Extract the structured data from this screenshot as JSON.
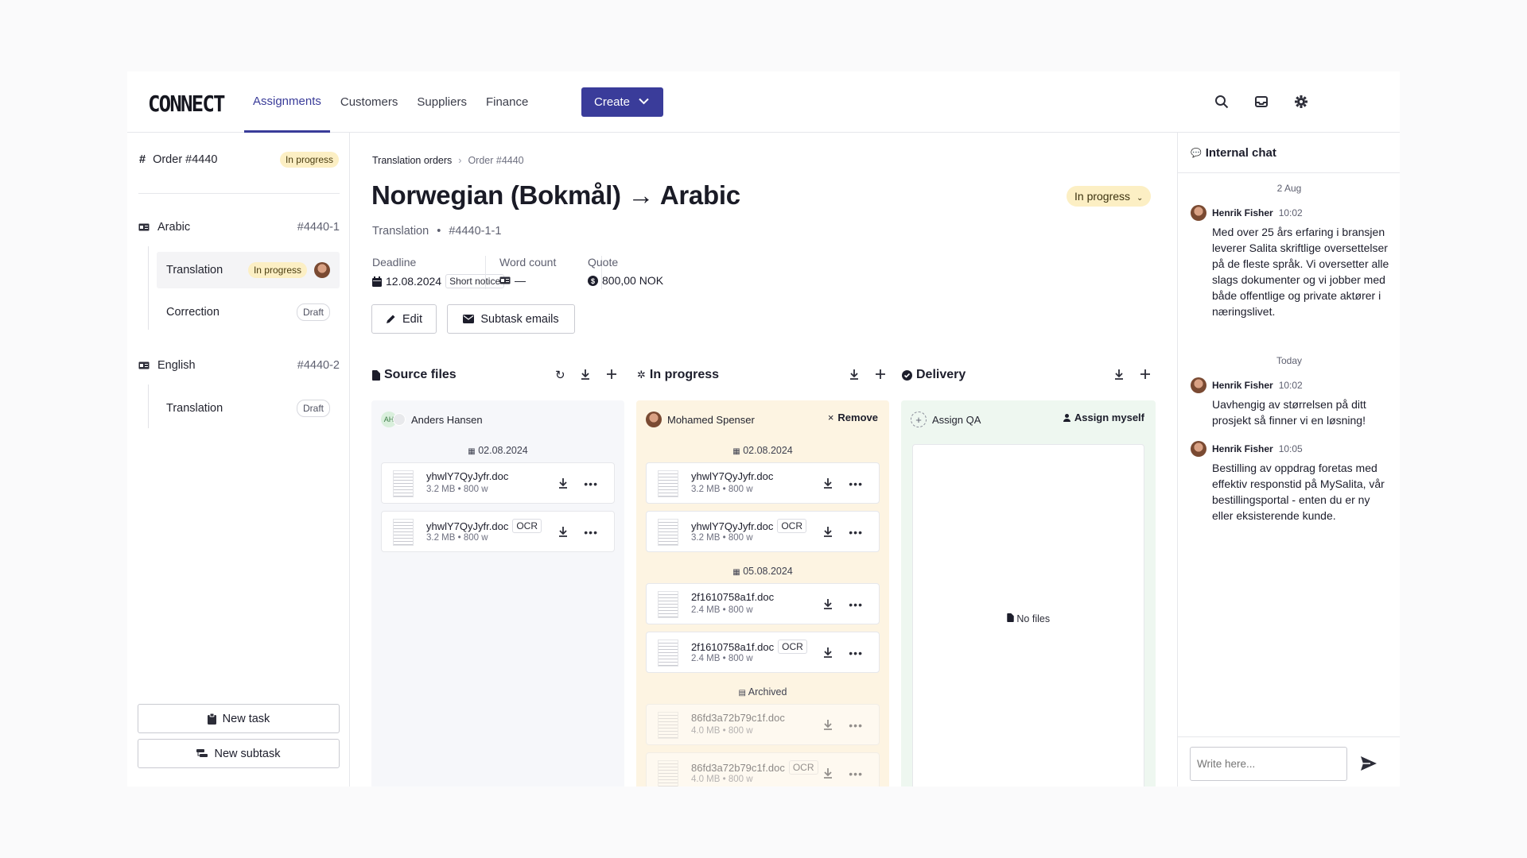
{
  "app": {
    "logo": "CONNECT"
  },
  "nav": {
    "items": [
      "Assignments",
      "Customers",
      "Suppliers",
      "Finance"
    ],
    "create_label": "Create"
  },
  "colors": {
    "accent": "#3a3c9a",
    "in_progress_bg": "#fcefc4",
    "progress_col_bg": "#fdf4e2",
    "delivery_col_bg": "#eef7f0",
    "source_col_bg": "#f6f7fa"
  },
  "sidebar": {
    "order": {
      "label": "Order #4440",
      "status": "In progress"
    },
    "groups": [
      {
        "language": "Arabic",
        "id": "#4440-1",
        "tasks": [
          {
            "label": "Translation",
            "status": "In progress"
          },
          {
            "label": "Correction",
            "status": "Draft"
          }
        ]
      },
      {
        "language": "English",
        "id": "#4440-2",
        "tasks": [
          {
            "label": "Translation",
            "status": "Draft"
          }
        ]
      }
    ],
    "new_task": "New task",
    "new_subtask": "New subtask"
  },
  "main": {
    "breadcrumb": [
      "Translation orders",
      "Order #4440"
    ],
    "title": "Norwegian (Bokmål) → Arabic",
    "status": "In progress",
    "subtitle_type": "Translation",
    "subtitle_id": "#4440-1-1",
    "deadline": {
      "label": "Deadline",
      "value": "12.08.2024",
      "tag": "Short notice"
    },
    "word_count": {
      "label": "Word count",
      "value": "—"
    },
    "quote": {
      "label": "Quote",
      "value": "800,00 NOK"
    },
    "edit_label": "Edit",
    "subtask_emails_label": "Subtask emails"
  },
  "columns": {
    "source": {
      "title": "Source files",
      "assignee_initials": "AH",
      "assignee": "Anders Hansen",
      "date": "02.08.2024",
      "files": [
        {
          "name": "yhwlY7QyJyfr.doc",
          "meta": "3.2 MB • 800 w",
          "ocr": ""
        },
        {
          "name": "yhwlY7QyJyfr.doc",
          "meta": "3.2 MB • 800 w",
          "ocr": "OCR"
        }
      ]
    },
    "progress": {
      "title": "In progress",
      "assignee": "Mohamed Spenser",
      "remove_label": "Remove",
      "date1": "02.08.2024",
      "date2": "05.08.2024",
      "archived_label": "Archived",
      "files": [
        {
          "name": "yhwlY7QyJyfr.doc",
          "meta": "3.2 MB • 800 w",
          "ocr": ""
        },
        {
          "name": "yhwlY7QyJyfr.doc",
          "meta": "3.2 MB • 800 w",
          "ocr": "OCR"
        },
        {
          "name": "2f1610758a1f.doc",
          "meta": "2.4 MB • 800 w",
          "ocr": ""
        },
        {
          "name": "2f1610758a1f.doc",
          "meta": "2.4 MB • 800 w",
          "ocr": "OCR"
        },
        {
          "name": "86fd3a72b79c1f.doc",
          "meta": "4.0 MB • 800 w",
          "ocr": ""
        },
        {
          "name": "86fd3a72b79c1f.doc",
          "meta": "4.0 MB • 800 w",
          "ocr": "OCR"
        }
      ]
    },
    "delivery": {
      "title": "Delivery",
      "assign_qa": "Assign QA",
      "assign_myself": "Assign myself",
      "empty": "No files"
    }
  },
  "chat": {
    "title": "Internal chat",
    "day1": "2 Aug",
    "day2": "Today",
    "messages": [
      {
        "author": "Henrik Fisher",
        "time": "10:02",
        "text": "Med over 25 års erfaring i bransjen leverer Salita skriftlige oversettelser på de fleste språk. Vi oversetter alle slags dokumenter og vi jobber med både offentlige og private aktører i næringslivet."
      },
      {
        "author": "Henrik Fisher",
        "time": "10:02",
        "text": "Uavhengig av størrelsen på ditt prosjekt så finner vi en løsning!"
      },
      {
        "author": "Henrik Fisher",
        "time": "10:05",
        "text": "Bestilling av oppdrag foretas med effektiv responstid på MySalita, vår bestillingsportal - enten du er ny eller eksisterende kunde."
      }
    ],
    "input_placeholder": "Write here..."
  }
}
